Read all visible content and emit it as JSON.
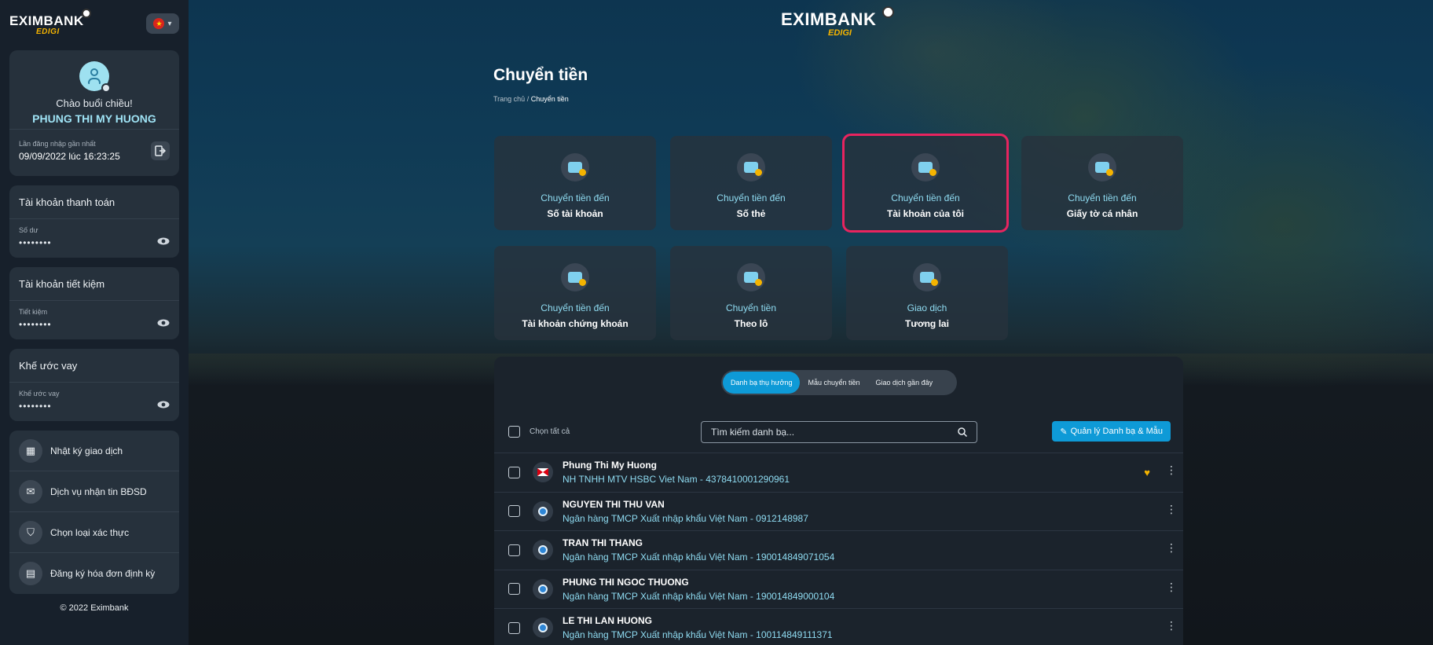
{
  "sidebar": {
    "logo": {
      "brand": "EXIMBANK",
      "sub": "EDIGI"
    },
    "language": {
      "flag": "★",
      "icon": "chevron-down-icon"
    },
    "profile": {
      "greeting": "Chào buổi chiều!",
      "name": "PHUNG THI MY HUONG",
      "last_login_label": "Lần đăng nhập gần nhất",
      "last_login_value": "09/09/2022 lúc 16:23:25"
    },
    "accounts": [
      {
        "title": "Tài khoản thanh toán",
        "sub": "Số dư",
        "value": "••••••••"
      },
      {
        "title": "Tài khoản tiết kiệm",
        "sub": "Tiết kiệm",
        "value": "••••••••"
      },
      {
        "title": "Khế ước vay",
        "sub": "Khế ước vay",
        "value": "••••••••"
      }
    ],
    "menu": [
      {
        "label": "Nhật ký giao dịch",
        "icon": "calendar-icon"
      },
      {
        "label": "Dịch vụ nhận tin BĐSD",
        "icon": "message-icon"
      },
      {
        "label": "Chọn loại xác thực",
        "icon": "shield-icon"
      },
      {
        "label": "Đăng ký hóa đơn định kỳ",
        "icon": "bill-icon"
      }
    ],
    "copyright": "© 2022 Eximbank"
  },
  "header": {
    "logo": {
      "brand": "EXIMBANK",
      "sub": "EDIGI"
    },
    "title": "Chuyển tiền",
    "breadcrumb": {
      "home": "Trang chủ",
      "sep": "/",
      "current": "Chuyển tiền"
    }
  },
  "tiles": [
    {
      "l1": "Chuyển tiền đến",
      "l2": "Số tài khoản",
      "icon": "account-number-icon"
    },
    {
      "l1": "Chuyển tiền đến",
      "l2": "Số thẻ",
      "icon": "card-icon"
    },
    {
      "l1": "Chuyển tiền đến",
      "l2": "Tài khoản của tôi",
      "icon": "my-account-icon",
      "selected": true
    },
    {
      "l1": "Chuyển tiền đến",
      "l2": "Giấy tờ cá nhân",
      "icon": "id-card-icon"
    },
    {
      "l1": "Chuyển tiền đến",
      "l2": "Tài khoản chứng khoán",
      "icon": "securities-icon"
    },
    {
      "l1": "Chuyển tiền",
      "l2": "Theo lô",
      "icon": "batch-icon"
    },
    {
      "l1": "Giao dịch",
      "l2": "Tương lai",
      "icon": "future-icon"
    }
  ],
  "contacts": {
    "tabs": [
      "Danh bạ thụ hưởng",
      "Mẫu chuyển tiền",
      "Giao dịch gần đây"
    ],
    "active_tab": 0,
    "select_all": "Chọn tất cả",
    "search_placeholder": "Tìm kiếm danh bạ...",
    "manage_button": "Quản lý Danh bạ & Mẫu",
    "rows": [
      {
        "name": "Phung Thi My Huong",
        "detail": "NH TNHH MTV HSBC Viet Nam - 4378410001290961",
        "bank": "hsbc",
        "favorite": true
      },
      {
        "name": "NGUYEN THI THU VAN",
        "detail": "Ngân hàng TMCP Xuất nhập khẩu Việt Nam - 0912148987",
        "bank": "eximbank",
        "favorite": false
      },
      {
        "name": "TRAN THI THANG",
        "detail": "Ngân hàng TMCP Xuất nhập khẩu Việt Nam - 190014849071054",
        "bank": "eximbank",
        "favorite": false
      },
      {
        "name": "PHUNG THI NGOC THUONG",
        "detail": "Ngân hàng TMCP Xuất nhập khẩu Việt Nam - 190014849000104",
        "bank": "eximbank",
        "favorite": false
      },
      {
        "name": "LE THI LAN HUONG",
        "detail": "Ngân hàng TMCP Xuất nhập khẩu Việt Nam - 100114849111371",
        "bank": "eximbank",
        "favorite": false
      }
    ]
  }
}
